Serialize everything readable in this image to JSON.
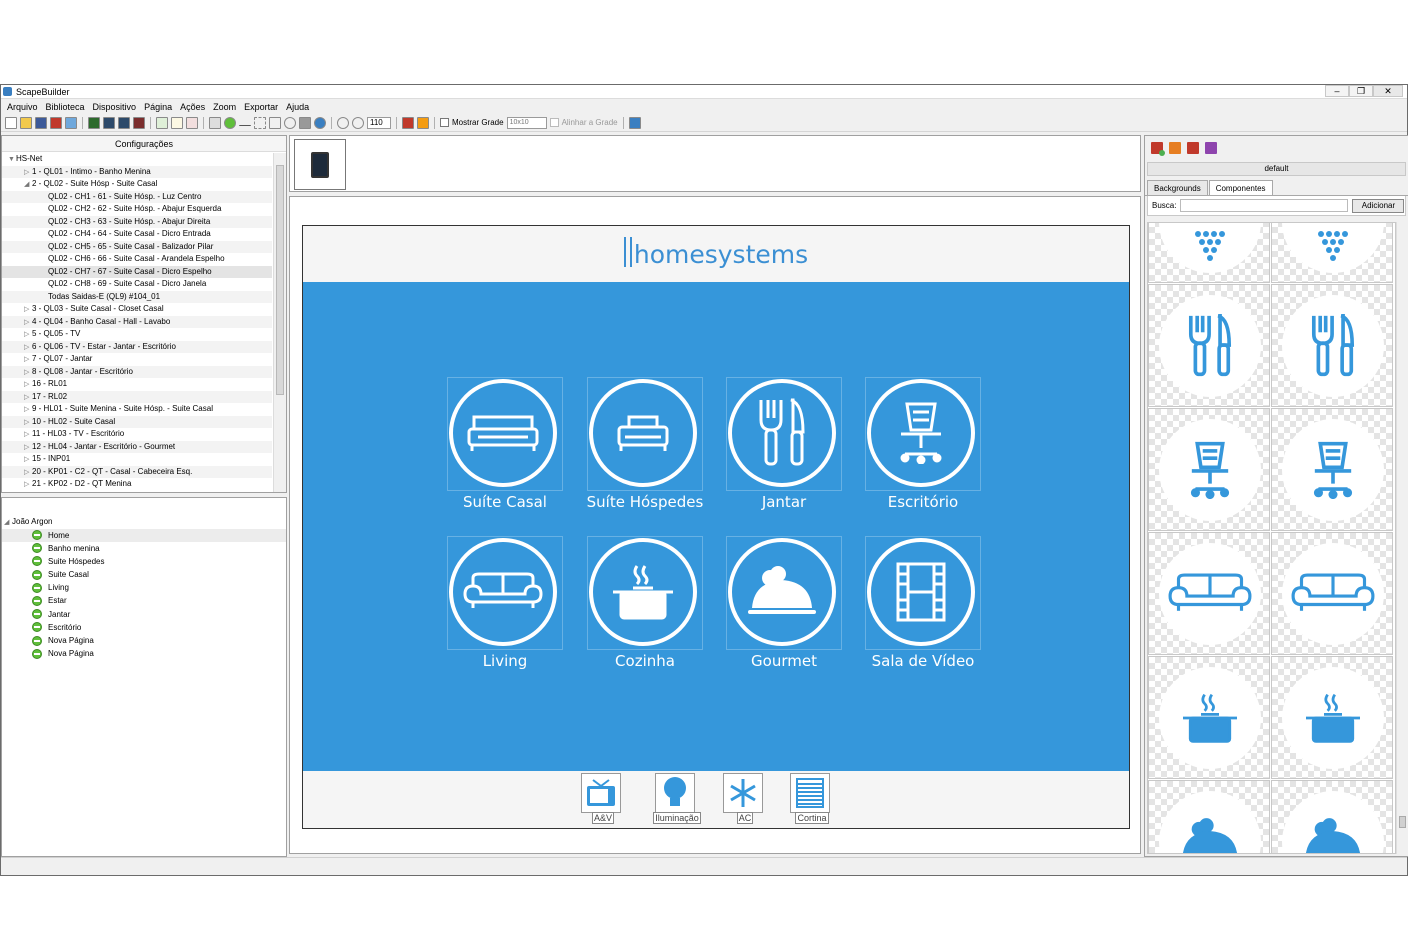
{
  "window": {
    "title": "ScapeBuilder"
  },
  "menu": [
    "Arquivo",
    "Biblioteca",
    "Dispositivo",
    "Página",
    "Ações",
    "Zoom",
    "Exportar",
    "Ajuda"
  ],
  "toolbar": {
    "zoom_value": "110",
    "show_grid_label": "Mostrar Grade",
    "grid_size": "10x10",
    "align_grid_label": "Alinhar a Grade"
  },
  "config_panel": {
    "title": "Configurações",
    "items": [
      {
        "label": "HS-Net",
        "arrow": "▼"
      },
      {
        "label": "1 - QL01 - Intimo - Banho Menina",
        "arrow": "▷"
      },
      {
        "label": "2 - QL02 - Suite Hósp - Suite Casal",
        "arrow": "◢"
      },
      {
        "label": "QL02 - CH1 - 61 - Suite Hósp. - Luz Centro",
        "arrow": ""
      },
      {
        "label": "QL02 - CH2 - 62 - Suite Hósp. - Abajur Esquerda",
        "arrow": ""
      },
      {
        "label": "QL02 - CH3 - 63 - Suite Hósp. - Abajur Direita",
        "arrow": ""
      },
      {
        "label": "QL02 - CH4 - 64 - Suite Casal - Dicro Entrada",
        "arrow": ""
      },
      {
        "label": "QL02 - CH5 - 65 - Suite Casal - Balizador Pilar",
        "arrow": ""
      },
      {
        "label": "QL02 - CH6 - 66 - Suite Casal - Arandela Espelho",
        "arrow": ""
      },
      {
        "label": "QL02 - CH7 - 67 - Suite Casal - Dicro Espelho",
        "arrow": ""
      },
      {
        "label": "QL02 - CH8 - 69 - Suite Casal - Dicro Janela",
        "arrow": ""
      },
      {
        "label": "Todas Saidas-E (QL9) #104_01",
        "arrow": ""
      },
      {
        "label": "3 - QL03 - Suite Casal - Closet Casal",
        "arrow": "▷"
      },
      {
        "label": "4 - QL04 - Banho Casal - Hall - Lavabo",
        "arrow": "▷"
      },
      {
        "label": "5 - QL05 - TV",
        "arrow": "▷"
      },
      {
        "label": "6 - QL06 - TV - Estar - Jantar - Escritório",
        "arrow": "▷"
      },
      {
        "label": "7 - QL07 - Jantar",
        "arrow": "▷"
      },
      {
        "label": "8 - QL08 - Jantar - Escritório",
        "arrow": "▷"
      },
      {
        "label": "16 - RL01",
        "arrow": "▷"
      },
      {
        "label": "17 - RL02",
        "arrow": "▷"
      },
      {
        "label": "9 - HL01 - Suite Menina - Suite Hósp. - Suite Casal",
        "arrow": "▷"
      },
      {
        "label": "10 - HL02 - Suite Casal",
        "arrow": "▷"
      },
      {
        "label": "11 - HL03 - TV - Escritório",
        "arrow": "▷"
      },
      {
        "label": "12 - HL04 - Jantar - Escritório - Gourmet",
        "arrow": "▷"
      },
      {
        "label": "15 - INP01",
        "arrow": "▷"
      },
      {
        "label": "20 - KP01 - C2 - QT - Casal - Cabeceira Esq.",
        "arrow": "▷"
      },
      {
        "label": "21 - KP02 - D2 - QT Menina",
        "arrow": "▷"
      }
    ]
  },
  "pages_panel": {
    "root": "João Argon",
    "pages": [
      "Home",
      "Banho menina",
      "Suite Hóspedes",
      "Suite Casal",
      "Living",
      "Estar",
      "Jantar",
      "Escritório",
      "Nova Página",
      "Nova Página"
    ]
  },
  "canvas": {
    "logo": "homesystems",
    "tiles": [
      {
        "label": "Suíte Casal",
        "icon": "bed-icon"
      },
      {
        "label": "Suíte Hóspedes",
        "icon": "single-bed-icon"
      },
      {
        "label": "Jantar",
        "icon": "fork-knife-icon"
      },
      {
        "label": "Escritório",
        "icon": "office-chair-icon"
      },
      {
        "label": "Living",
        "icon": "sofa-icon"
      },
      {
        "label": "Cozinha",
        "icon": "cooking-pot-icon"
      },
      {
        "label": "Gourmet",
        "icon": "cloche-icon"
      },
      {
        "label": "Sala de Vídeo",
        "icon": "film-icon"
      }
    ],
    "bottom": [
      {
        "label": "A&V",
        "icon": "tv-icon"
      },
      {
        "label": "Iluminação",
        "icon": "bulb-icon"
      },
      {
        "label": "AC",
        "icon": "snowflake-icon"
      },
      {
        "label": "Cortina",
        "icon": "blind-icon"
      }
    ]
  },
  "right_panel": {
    "style_name": "default",
    "tabs": [
      "Backgrounds",
      "Componentes"
    ],
    "search_label": "Busca:",
    "add_button": "Adicionar"
  },
  "colors": {
    "accent_blue": "#3597db"
  }
}
